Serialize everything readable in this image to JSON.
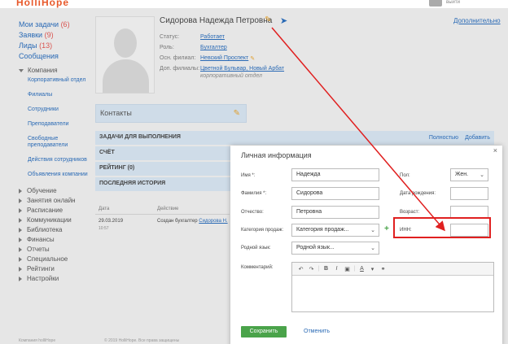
{
  "colors": {
    "accent": "#2a6ab5",
    "count": "#d9534f",
    "save": "#4aa34a",
    "highlight": "#e02020"
  },
  "sidebar": {
    "my_tasks": "Мои задачи",
    "my_tasks_count": "(6)",
    "requests": "Заявки",
    "requests_count": "(9)",
    "leads": "Лиды",
    "leads_count": "(13)",
    "messages": "Сообщения",
    "company": "Компания",
    "company_items": [
      "Корпоративный отдел",
      "Филиалы",
      "Сотрудники",
      "Преподаватели",
      "Свободные преподаватели",
      "Действия сотрудников",
      "Объявления компании"
    ],
    "sections": [
      "Обучение",
      "Занятия онлайн",
      "Расписание",
      "Коммуникации",
      "Библиотека",
      "Финансы",
      "Отчеты",
      "Специальное",
      "Рейтинги",
      "Настройки"
    ]
  },
  "profile": {
    "name": "Сидорова Надежда Петровна",
    "more_link": "Дополнительно",
    "status_label": "Статус:",
    "status_value": "Работает",
    "role_label": "Роль:",
    "role_value": "Бухгалтер",
    "main_branch_label": "Осн. филиал:",
    "main_branch_value": "Невский Проспект",
    "extra_branches_label": "Доп. филиалы:",
    "extra_branches_value": "Цветной Бульвар, Новый Арбат",
    "extra_branches_dept": "корпоративный отдел"
  },
  "contacts": {
    "title": "Контакты"
  },
  "bars": {
    "tasks": "ЗАДАЧИ ДЛЯ ВЫПОЛНЕНИЯ",
    "tasks_full": "Полностью",
    "tasks_add": "Добавить",
    "invoice": "СЧЁТ",
    "rating": "РЕЙТИНГ (0)",
    "history": "ПОСЛЕДНЯЯ ИСТОРИЯ"
  },
  "history": {
    "col_date": "Дата",
    "col_action": "Действие",
    "date": "29.03.2019",
    "time": "10:57",
    "text": "Создан бухгалтер",
    "link": "Сидорова Н."
  },
  "footer": {
    "left": "Компания holliHope",
    "middle": "© 2019 HolliHope. Все права защищены"
  },
  "modal": {
    "title": "Личная информация",
    "close": "×",
    "name_label": "Имя *:",
    "name_value": "Надежда",
    "surname_label": "Фамилия *:",
    "surname_value": "Сидорова",
    "patronymic_label": "Отчество:",
    "patronymic_value": "Петровна",
    "category_label": "Категория продаж:",
    "category_value": "Категория продаж...",
    "language_label": "Родной язык:",
    "language_value": "Родной язык...",
    "gender_label": "Пол:",
    "gender_value": "Жен.",
    "birthdate_label": "Дата рождения:",
    "age_label": "Возраст:",
    "inn_label": "ИНН:",
    "comment_label": "Комментарий:",
    "save": "Сохранить",
    "cancel": "Отменить"
  }
}
